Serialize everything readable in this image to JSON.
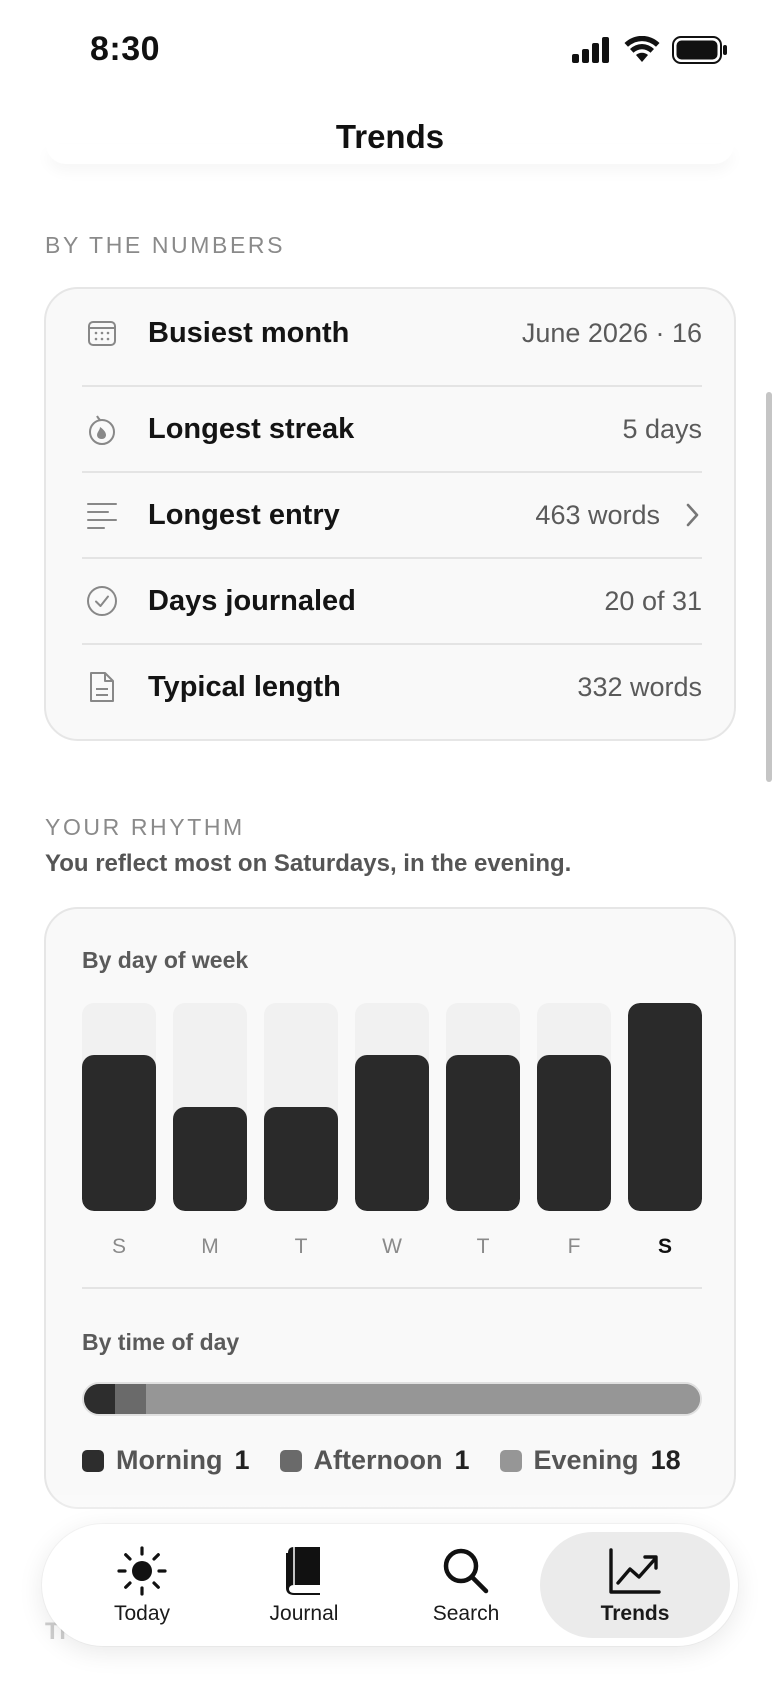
{
  "status_bar": {
    "time": "8:30"
  },
  "nav": {
    "title": "Trends"
  },
  "numbers_section": {
    "header": "BY THE NUMBERS",
    "rows": [
      {
        "icon": "calendar-icon",
        "label": "Busiest month",
        "value": "June 2026 · 16",
        "has_chevron": false
      },
      {
        "icon": "flame-icon",
        "label": "Longest streak",
        "value": "5 days",
        "has_chevron": false
      },
      {
        "icon": "text-lines-icon",
        "label": "Longest entry",
        "value": "463 words",
        "has_chevron": true
      },
      {
        "icon": "check-circle-icon",
        "label": "Days journaled",
        "value": "20 of 31",
        "has_chevron": false
      },
      {
        "icon": "document-icon",
        "label": "Typical length",
        "value": "332 words",
        "has_chevron": false
      }
    ]
  },
  "rhythm_section": {
    "header": "YOUR RHYTHM",
    "subtitle": "You reflect most on Saturdays, in the evening.",
    "by_day_label": "By day of week",
    "by_time_label": "By time of day"
  },
  "chart_data": [
    {
      "type": "bar",
      "title": "By day of week",
      "categories": [
        "S",
        "M",
        "T",
        "W",
        "T",
        "F",
        "S"
      ],
      "values": [
        3,
        2,
        2,
        3,
        3,
        3,
        4
      ],
      "ylim": [
        0,
        4
      ],
      "highlight_index": 6,
      "colors": {
        "bar": "#2a2a2a",
        "track": "#f1f1f1"
      }
    },
    {
      "type": "bar",
      "orientation": "stacked-horizontal",
      "title": "By time of day",
      "series": [
        {
          "name": "Morning",
          "value": 1,
          "color": "#2d2d2d"
        },
        {
          "name": "Afternoon",
          "value": 1,
          "color": "#6a6a6a"
        },
        {
          "name": "Evening",
          "value": 18,
          "color": "#969696"
        }
      ]
    }
  ],
  "tabbar": {
    "tabs": [
      {
        "icon": "sun-icon",
        "label": "Today",
        "active": false
      },
      {
        "icon": "book-icon",
        "label": "Journal",
        "active": false
      },
      {
        "icon": "search-icon",
        "label": "Search",
        "active": false
      },
      {
        "icon": "trend-chart-icon",
        "label": "Trends",
        "active": true
      }
    ]
  },
  "background_text": "Ti"
}
